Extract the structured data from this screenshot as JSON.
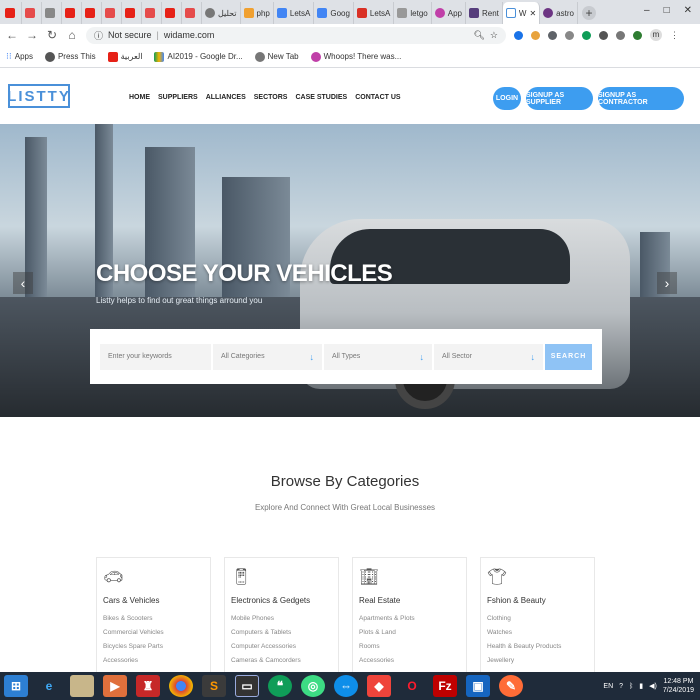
{
  "browser": {
    "tabs": [
      "",
      "",
      "",
      "",
      "",
      "",
      "",
      "",
      "",
      "",
      "تحليل",
      "php",
      "LetsA",
      "Goog",
      "LetsA",
      "letgo",
      "App",
      "Rent",
      "W",
      "astro"
    ],
    "new_tab_symbol": "+",
    "window_controls": [
      "–",
      "□",
      "✕"
    ],
    "address": {
      "security_label": "Not secure",
      "url": "widame.com"
    },
    "profile_initial": "m",
    "bookmarks": [
      "Apps",
      "Press This",
      "العربية",
      "AI2019 - Google Dr...",
      "New Tab",
      "Whoops! There was..."
    ]
  },
  "site": {
    "logo": "LISTTY",
    "nav": [
      "HOME",
      "SUPPLIERS",
      "ALLIANCES",
      "SECTORS",
      "CASE STUDIES",
      "CONTACT US"
    ],
    "buttons": {
      "login": "LOGIN",
      "signup_supplier": "SIGNUP AS SUPPLIER",
      "signup_contractor": "SIGNUP AS CONTRACTOR"
    }
  },
  "hero": {
    "title": "CHOOSE YOUR VEHICLES",
    "subtitle": "Listty helps to find out great things arround you",
    "prev_arrow": "‹",
    "next_arrow": "›",
    "search": {
      "keywords_placeholder": "Enter your keywords",
      "categories": "All Categories",
      "types": "All Types",
      "sector": "All Sector",
      "button": "SEARCH",
      "caret": "↓"
    }
  },
  "categories_section": {
    "title": "Browse By Categories",
    "subtitle": "Explore And Connect With Great Local Businesses",
    "cards": [
      {
        "icon": "car-icon",
        "title": "Cars & Vehicles",
        "items": [
          "Bikes & Scooters",
          "Commercial Vehicles",
          "Bicycles Spare Parts",
          "Accessories"
        ]
      },
      {
        "icon": "phone-icon",
        "title": "Electronics & Gedgets",
        "items": [
          "Mobile Phones",
          "Computers & Tablets",
          "Computer Accessories",
          "Cameras & Camcorders"
        ]
      },
      {
        "icon": "building-icon",
        "title": "Real Estate",
        "items": [
          "Apartments & Plots",
          "Plots & Land",
          "Rooms",
          "Accessories"
        ]
      },
      {
        "icon": "shirt-icon",
        "title": "Fshion & Beauty",
        "items": [
          "Clothing",
          "Watches",
          "Health & Beauty Products",
          "Jewellery"
        ]
      }
    ]
  },
  "taskbar": {
    "language": "EN",
    "time": "12:48 PM",
    "date": "7/24/2019"
  },
  "colors": {
    "accent": "#3d9df0",
    "logo": "#4a90d9",
    "taskbar": "#1f2b3a"
  }
}
